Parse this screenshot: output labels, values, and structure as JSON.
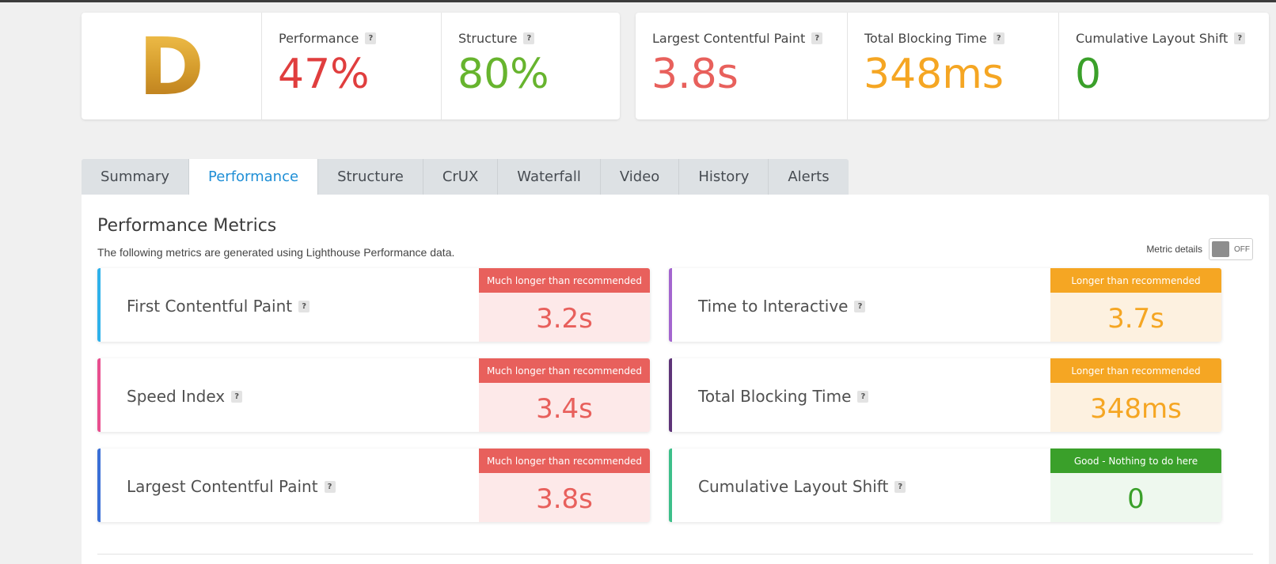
{
  "grade": {
    "letter": "D"
  },
  "scores": [
    {
      "label": "Performance",
      "value": "47%",
      "color": "#e03e3e"
    },
    {
      "label": "Structure",
      "value": "80%",
      "color": "#67b42e"
    }
  ],
  "vitals": [
    {
      "label": "Largest Contentful Paint",
      "value": "3.8s",
      "color": "#e8605c"
    },
    {
      "label": "Total Blocking Time",
      "value": "348ms",
      "color": "#f5a623"
    },
    {
      "label": "Cumulative Layout Shift",
      "value": "0",
      "color": "#3aa02a"
    }
  ],
  "help_glyph": "?",
  "tabs": [
    "Summary",
    "Performance",
    "Structure",
    "CrUX",
    "Waterfall",
    "Video",
    "History",
    "Alerts"
  ],
  "active_tab": "Performance",
  "panel": {
    "title": "Performance Metrics",
    "description": "The following metrics are generated using Lighthouse Performance data.",
    "metric_details_label": "Metric details",
    "metric_details_state": "OFF"
  },
  "metrics": [
    {
      "label": "First Contentful Paint",
      "status": "Much longer than recommended",
      "value": "3.2s",
      "accent": "#2fb1ea",
      "status_color": "#e8605c",
      "value_bg": "#fde9e9",
      "value_color": "#e8605c"
    },
    {
      "label": "Time to Interactive",
      "status": "Longer than recommended",
      "value": "3.7s",
      "accent": "#a466cf",
      "status_color": "#f5a623",
      "value_bg": "#fdf1e0",
      "value_color": "#f5a623"
    },
    {
      "label": "Speed Index",
      "status": "Much longer than recommended",
      "value": "3.4s",
      "accent": "#e84f8f",
      "status_color": "#e8605c",
      "value_bg": "#fde9e9",
      "value_color": "#e8605c"
    },
    {
      "label": "Total Blocking Time",
      "status": "Longer than recommended",
      "value": "348ms",
      "accent": "#5e3478",
      "status_color": "#f5a623",
      "value_bg": "#fdf1e0",
      "value_color": "#f5a623"
    },
    {
      "label": "Largest Contentful Paint",
      "status": "Much longer than recommended",
      "value": "3.8s",
      "accent": "#3a6fd6",
      "status_color": "#e8605c",
      "value_bg": "#fde9e9",
      "value_color": "#e8605c"
    },
    {
      "label": "Cumulative Layout Shift",
      "status": "Good - Nothing to do here",
      "value": "0",
      "accent": "#3dbf8a",
      "status_color": "#3aa02a",
      "value_bg": "#eef8ee",
      "value_color": "#3aa02a"
    }
  ]
}
